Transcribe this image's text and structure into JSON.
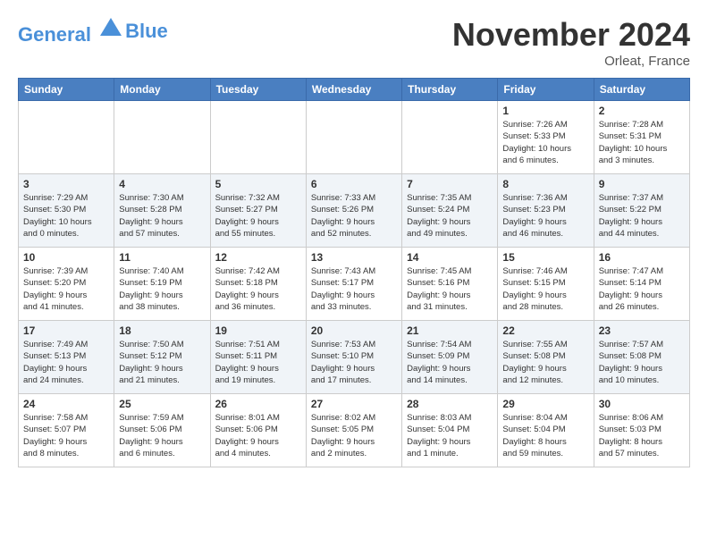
{
  "header": {
    "logo_line1": "General",
    "logo_line2": "Blue",
    "month": "November 2024",
    "location": "Orleat, France"
  },
  "weekdays": [
    "Sunday",
    "Monday",
    "Tuesday",
    "Wednesday",
    "Thursday",
    "Friday",
    "Saturday"
  ],
  "weeks": [
    [
      {
        "day": "",
        "info": ""
      },
      {
        "day": "",
        "info": ""
      },
      {
        "day": "",
        "info": ""
      },
      {
        "day": "",
        "info": ""
      },
      {
        "day": "",
        "info": ""
      },
      {
        "day": "1",
        "info": "Sunrise: 7:26 AM\nSunset: 5:33 PM\nDaylight: 10 hours\nand 6 minutes."
      },
      {
        "day": "2",
        "info": "Sunrise: 7:28 AM\nSunset: 5:31 PM\nDaylight: 10 hours\nand 3 minutes."
      }
    ],
    [
      {
        "day": "3",
        "info": "Sunrise: 7:29 AM\nSunset: 5:30 PM\nDaylight: 10 hours\nand 0 minutes."
      },
      {
        "day": "4",
        "info": "Sunrise: 7:30 AM\nSunset: 5:28 PM\nDaylight: 9 hours\nand 57 minutes."
      },
      {
        "day": "5",
        "info": "Sunrise: 7:32 AM\nSunset: 5:27 PM\nDaylight: 9 hours\nand 55 minutes."
      },
      {
        "day": "6",
        "info": "Sunrise: 7:33 AM\nSunset: 5:26 PM\nDaylight: 9 hours\nand 52 minutes."
      },
      {
        "day": "7",
        "info": "Sunrise: 7:35 AM\nSunset: 5:24 PM\nDaylight: 9 hours\nand 49 minutes."
      },
      {
        "day": "8",
        "info": "Sunrise: 7:36 AM\nSunset: 5:23 PM\nDaylight: 9 hours\nand 46 minutes."
      },
      {
        "day": "9",
        "info": "Sunrise: 7:37 AM\nSunset: 5:22 PM\nDaylight: 9 hours\nand 44 minutes."
      }
    ],
    [
      {
        "day": "10",
        "info": "Sunrise: 7:39 AM\nSunset: 5:20 PM\nDaylight: 9 hours\nand 41 minutes."
      },
      {
        "day": "11",
        "info": "Sunrise: 7:40 AM\nSunset: 5:19 PM\nDaylight: 9 hours\nand 38 minutes."
      },
      {
        "day": "12",
        "info": "Sunrise: 7:42 AM\nSunset: 5:18 PM\nDaylight: 9 hours\nand 36 minutes."
      },
      {
        "day": "13",
        "info": "Sunrise: 7:43 AM\nSunset: 5:17 PM\nDaylight: 9 hours\nand 33 minutes."
      },
      {
        "day": "14",
        "info": "Sunrise: 7:45 AM\nSunset: 5:16 PM\nDaylight: 9 hours\nand 31 minutes."
      },
      {
        "day": "15",
        "info": "Sunrise: 7:46 AM\nSunset: 5:15 PM\nDaylight: 9 hours\nand 28 minutes."
      },
      {
        "day": "16",
        "info": "Sunrise: 7:47 AM\nSunset: 5:14 PM\nDaylight: 9 hours\nand 26 minutes."
      }
    ],
    [
      {
        "day": "17",
        "info": "Sunrise: 7:49 AM\nSunset: 5:13 PM\nDaylight: 9 hours\nand 24 minutes."
      },
      {
        "day": "18",
        "info": "Sunrise: 7:50 AM\nSunset: 5:12 PM\nDaylight: 9 hours\nand 21 minutes."
      },
      {
        "day": "19",
        "info": "Sunrise: 7:51 AM\nSunset: 5:11 PM\nDaylight: 9 hours\nand 19 minutes."
      },
      {
        "day": "20",
        "info": "Sunrise: 7:53 AM\nSunset: 5:10 PM\nDaylight: 9 hours\nand 17 minutes."
      },
      {
        "day": "21",
        "info": "Sunrise: 7:54 AM\nSunset: 5:09 PM\nDaylight: 9 hours\nand 14 minutes."
      },
      {
        "day": "22",
        "info": "Sunrise: 7:55 AM\nSunset: 5:08 PM\nDaylight: 9 hours\nand 12 minutes."
      },
      {
        "day": "23",
        "info": "Sunrise: 7:57 AM\nSunset: 5:08 PM\nDaylight: 9 hours\nand 10 minutes."
      }
    ],
    [
      {
        "day": "24",
        "info": "Sunrise: 7:58 AM\nSunset: 5:07 PM\nDaylight: 9 hours\nand 8 minutes."
      },
      {
        "day": "25",
        "info": "Sunrise: 7:59 AM\nSunset: 5:06 PM\nDaylight: 9 hours\nand 6 minutes."
      },
      {
        "day": "26",
        "info": "Sunrise: 8:01 AM\nSunset: 5:06 PM\nDaylight: 9 hours\nand 4 minutes."
      },
      {
        "day": "27",
        "info": "Sunrise: 8:02 AM\nSunset: 5:05 PM\nDaylight: 9 hours\nand 2 minutes."
      },
      {
        "day": "28",
        "info": "Sunrise: 8:03 AM\nSunset: 5:04 PM\nDaylight: 9 hours\nand 1 minute."
      },
      {
        "day": "29",
        "info": "Sunrise: 8:04 AM\nSunset: 5:04 PM\nDaylight: 8 hours\nand 59 minutes."
      },
      {
        "day": "30",
        "info": "Sunrise: 8:06 AM\nSunset: 5:03 PM\nDaylight: 8 hours\nand 57 minutes."
      }
    ]
  ]
}
